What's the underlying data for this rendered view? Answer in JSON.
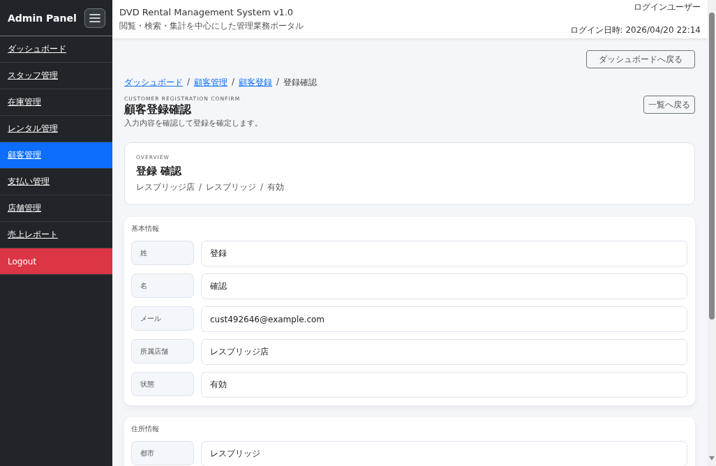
{
  "sidebar": {
    "brand": "Admin Panel",
    "items": [
      {
        "label": "ダッシュボード",
        "selected": false,
        "kind": "nav"
      },
      {
        "label": "スタッフ管理",
        "selected": false,
        "kind": "nav"
      },
      {
        "label": "在庫管理",
        "selected": false,
        "kind": "nav"
      },
      {
        "label": "レンタル管理",
        "selected": false,
        "kind": "nav"
      },
      {
        "label": "顧客管理",
        "selected": true,
        "kind": "nav"
      },
      {
        "label": "支払い管理",
        "selected": false,
        "kind": "nav"
      },
      {
        "label": "店舗管理",
        "selected": false,
        "kind": "nav"
      },
      {
        "label": "売上レポート",
        "selected": false,
        "kind": "nav"
      },
      {
        "label": "Logout",
        "selected": false,
        "kind": "logout"
      }
    ]
  },
  "header": {
    "title": "DVD Rental Management System v1.0",
    "subtitle": "閲覧・検索・集計を中心にした管理業務ポータル",
    "user_label": "ログインユーザー",
    "login_time": "ログイン日時: 2026/04/20 22:14"
  },
  "back_button": "ダッシュボードへ戻る",
  "breadcrumb_separator": "/",
  "breadcrumb": [
    {
      "label": "ダッシュボード",
      "link": true
    },
    {
      "label": "顧客管理",
      "link": true
    },
    {
      "label": "顧客登録",
      "link": true
    },
    {
      "label": "登録確認",
      "link": false
    }
  ],
  "page": {
    "eyebrow": "CUSTOMER REGISTRATION CONFIRM",
    "title": "顧客登録確認",
    "description": "入力内容を確認して登録を確定します。",
    "list_button": "一覧へ戻る"
  },
  "overview": {
    "eyebrow": "OVERVIEW",
    "title": "登録 確認",
    "meta": [
      "レスブリッジ店",
      "レスブリッジ",
      "有効"
    ],
    "meta_separator": "/"
  },
  "sections": [
    {
      "title": "基本情報",
      "fields": [
        {
          "label": "姓",
          "value": "登録"
        },
        {
          "label": "名",
          "value": "確認"
        },
        {
          "label": "メール",
          "value": "cust492646@example.com"
        },
        {
          "label": "所属店舗",
          "value": "レスブリッジ店"
        },
        {
          "label": "状態",
          "value": "有効"
        }
      ]
    },
    {
      "title": "住所情報",
      "fields": [
        {
          "label": "都市",
          "value": "レスブリッジ"
        }
      ]
    }
  ]
}
